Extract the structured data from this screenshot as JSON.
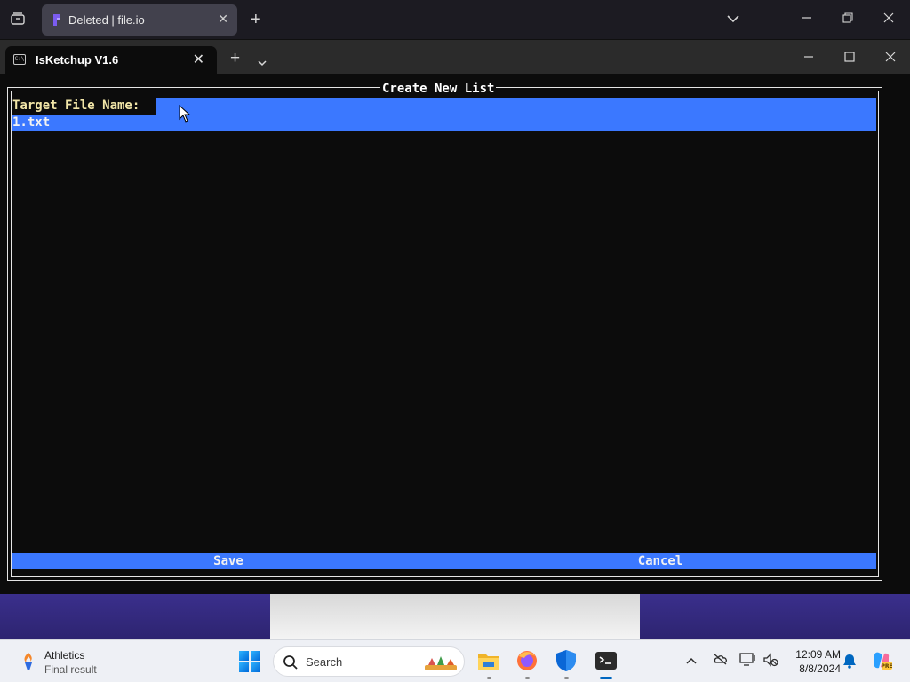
{
  "browser": {
    "tab_title": "Deleted | file.io",
    "tab_close": "✕",
    "new_tab": "+",
    "list_tabs": "⌄",
    "minimize": "─",
    "restore": "❐",
    "close": "✕"
  },
  "terminal": {
    "tab_title": "IsKetchup V1.6",
    "tab_icon_text": "C:\\",
    "tab_close": "✕",
    "new_tab": "+",
    "dropdown": "⌄",
    "minimize": "─",
    "maximize": "☐",
    "close": "✕"
  },
  "dialog": {
    "title": "Create New List",
    "field_label": "Target File Name:",
    "field_value": "1.txt",
    "save_label": "Save",
    "cancel_label": "Cancel"
  },
  "taskbar": {
    "widget_title": "Athletics",
    "widget_subtitle": "Final result",
    "search_placeholder": "Search",
    "apps": [
      "file-explorer",
      "firefox",
      "windows-security",
      "terminal"
    ],
    "tray": {
      "chevron": "^",
      "time": "12:09 AM",
      "date": "8/8/2024"
    },
    "accent_color": "#0067c0"
  },
  "colors": {
    "terminal_bg": "#0c0c0c",
    "highlight_blue": "#3b78ff",
    "label_yellow": "#f2e6a8",
    "border_white": "#e6e6e6"
  }
}
